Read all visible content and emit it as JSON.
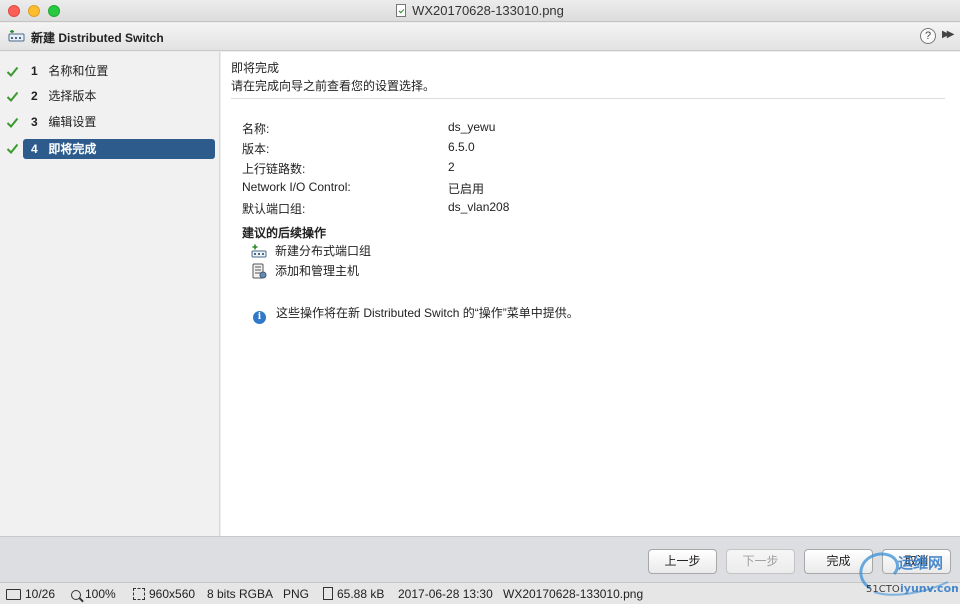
{
  "window": {
    "file_title": "WX20170628-133010.png"
  },
  "wizard": {
    "title": "新建 Distributed Switch",
    "help_symbol": "?",
    "expand_symbol": "▶▶"
  },
  "steps": [
    {
      "num": "1",
      "label": "名称和位置",
      "done": true,
      "active": false
    },
    {
      "num": "2",
      "label": "选择版本",
      "done": true,
      "active": false
    },
    {
      "num": "3",
      "label": "编辑设置",
      "done": true,
      "active": false
    },
    {
      "num": "4",
      "label": "即将完成",
      "done": true,
      "active": true
    }
  ],
  "main": {
    "title": "即将完成",
    "subtitle": "请在完成向导之前查看您的设置选择。",
    "settings": [
      {
        "label": "名称:",
        "value": "ds_yewu"
      },
      {
        "label": "版本:",
        "value": "6.5.0"
      },
      {
        "label": "上行链路数:",
        "value": "2"
      },
      {
        "label": "Network I/O Control:",
        "value": "已启用"
      },
      {
        "label": "默认端口组:",
        "value": "ds_vlan208"
      }
    ],
    "next_actions_title": "建议的后续操作",
    "next_actions": [
      {
        "label": "新建分布式端口组",
        "icon": "new-port-group-icon"
      },
      {
        "label": "添加和管理主机",
        "icon": "manage-hosts-icon"
      }
    ],
    "info_text": "这些操作将在新 Distributed Switch 的“操作”菜单中提供。"
  },
  "buttons": {
    "back": "上一步",
    "next": "下一步",
    "finish": "完成",
    "cancel": "取消"
  },
  "statusbar": {
    "page": "10/26",
    "zoom": "100%",
    "dimensions": "960x560",
    "color_depth": "8 bits RGBA",
    "format": "PNG",
    "size": "65.88 kB",
    "date": "2017-06-28 13:30",
    "filename": "WX20170628-133010.png"
  },
  "watermark": {
    "text": "运维网",
    "sub": "51CTO",
    "domain": "iyunv.com"
  },
  "colors": {
    "active_step": "#2d5c8c",
    "check": "#3a9a2e",
    "info": "#2f79c8"
  }
}
